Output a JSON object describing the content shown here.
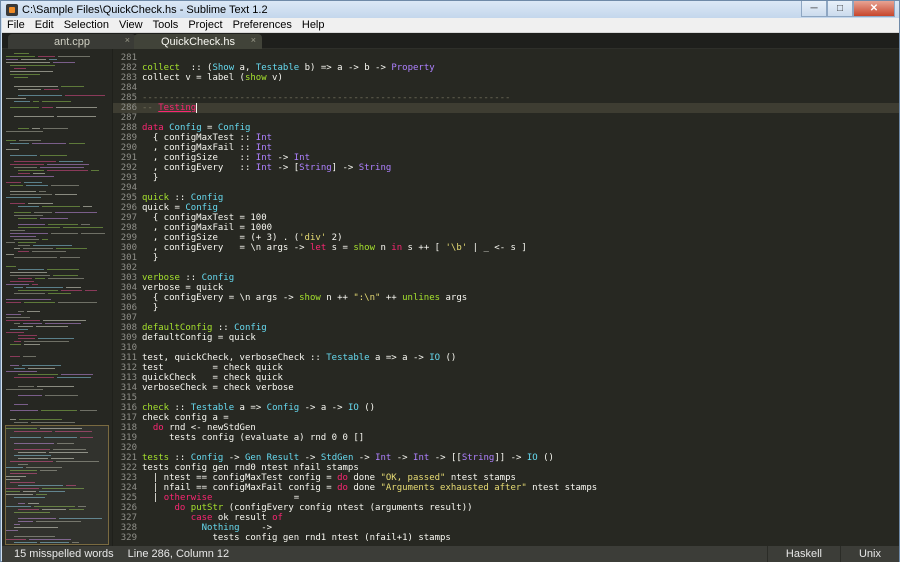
{
  "window": {
    "title": "C:\\Sample Files\\QuickCheck.hs - Sublime Text 1.2",
    "controls": [
      "minimize",
      "maximize",
      "close"
    ]
  },
  "menubar": {
    "items": [
      "File",
      "Edit",
      "Selection",
      "View",
      "Tools",
      "Project",
      "Preferences",
      "Help"
    ]
  },
  "tabs": [
    {
      "label": "ant.cpp",
      "active": false,
      "close": "×"
    },
    {
      "label": "QuickCheck.hs",
      "active": true,
      "close": "×"
    }
  ],
  "editor": {
    "current_line": "286",
    "lines": [
      {
        "n": "281",
        "tokens": []
      },
      {
        "n": "282",
        "tokens": [
          [
            "f",
            "collect"
          ],
          [
            "",
            "  :: ("
          ],
          [
            "t",
            "Show"
          ],
          [
            "",
            " a, "
          ],
          [
            "t",
            "Testable"
          ],
          [
            "",
            " b) => a -> b -> "
          ],
          [
            "typ",
            "Property"
          ]
        ]
      },
      {
        "n": "283",
        "tokens": [
          [
            "",
            "collect v = label ("
          ],
          [
            "f",
            "show"
          ],
          [
            "",
            " v)"
          ]
        ]
      },
      {
        "n": "284",
        "tokens": []
      },
      {
        "n": "285",
        "tokens": [
          [
            "c",
            "--------------------------------------------------------------------"
          ]
        ]
      },
      {
        "n": "286",
        "tokens": [
          [
            "c",
            "-- "
          ],
          [
            "err",
            "Testing"
          ]
        ]
      },
      {
        "n": "287",
        "tokens": []
      },
      {
        "n": "288",
        "tokens": [
          [
            "k",
            "data"
          ],
          [
            "",
            " "
          ],
          [
            "t",
            "Config"
          ],
          [
            "",
            " = "
          ],
          [
            "t",
            "Config"
          ]
        ]
      },
      {
        "n": "289",
        "tokens": [
          [
            "",
            "  { configMaxTest :: "
          ],
          [
            "typ",
            "Int"
          ]
        ]
      },
      {
        "n": "290",
        "tokens": [
          [
            "",
            "  , configMaxFail :: "
          ],
          [
            "typ",
            "Int"
          ]
        ]
      },
      {
        "n": "291",
        "tokens": [
          [
            "",
            "  , configSize    :: "
          ],
          [
            "typ",
            "Int"
          ],
          [
            "",
            " -> "
          ],
          [
            "typ",
            "Int"
          ]
        ]
      },
      {
        "n": "292",
        "tokens": [
          [
            "",
            "  , configEvery   :: "
          ],
          [
            "typ",
            "Int"
          ],
          [
            "",
            " -> ["
          ],
          [
            "typ",
            "String"
          ],
          [
            "",
            "] -> "
          ],
          [
            "typ",
            "String"
          ]
        ]
      },
      {
        "n": "293",
        "tokens": [
          [
            "",
            "  }"
          ]
        ]
      },
      {
        "n": "294",
        "tokens": []
      },
      {
        "n": "295",
        "tokens": [
          [
            "f",
            "quick"
          ],
          [
            "",
            " :: "
          ],
          [
            "t",
            "Config"
          ]
        ]
      },
      {
        "n": "296",
        "tokens": [
          [
            "",
            "quick = "
          ],
          [
            "t",
            "Config"
          ]
        ]
      },
      {
        "n": "297",
        "tokens": [
          [
            "",
            "  { configMaxTest = 100"
          ]
        ]
      },
      {
        "n": "298",
        "tokens": [
          [
            "",
            "  , configMaxFail = 1000"
          ]
        ]
      },
      {
        "n": "299",
        "tokens": [
          [
            "",
            "  , configSize    = (+ 3) . ("
          ],
          [
            "s",
            "'div'"
          ],
          [
            "",
            " 2)"
          ]
        ]
      },
      {
        "n": "300",
        "tokens": [
          [
            "",
            "  , configEvery   = \\n args -> "
          ],
          [
            "k",
            "let"
          ],
          [
            "",
            " s = "
          ],
          [
            "f",
            "show"
          ],
          [
            "",
            " n "
          ],
          [
            "k",
            "in"
          ],
          [
            "",
            " s ++ [ "
          ],
          [
            "s",
            "'\\b'"
          ],
          [
            "",
            " | _ <- s ]"
          ]
        ]
      },
      {
        "n": "301",
        "tokens": [
          [
            "",
            "  }"
          ]
        ]
      },
      {
        "n": "302",
        "tokens": []
      },
      {
        "n": "303",
        "tokens": [
          [
            "f",
            "verbose"
          ],
          [
            "",
            " :: "
          ],
          [
            "t",
            "Config"
          ]
        ]
      },
      {
        "n": "304",
        "tokens": [
          [
            "",
            "verbose = quick"
          ]
        ]
      },
      {
        "n": "305",
        "tokens": [
          [
            "",
            "  { configEvery = \\n args -> "
          ],
          [
            "f",
            "show"
          ],
          [
            "",
            " n ++ "
          ],
          [
            "s",
            "\":\\n\""
          ],
          [
            "",
            " ++ "
          ],
          [
            "f",
            "unlines"
          ],
          [
            "",
            " args"
          ]
        ]
      },
      {
        "n": "306",
        "tokens": [
          [
            "",
            "  }"
          ]
        ]
      },
      {
        "n": "307",
        "tokens": []
      },
      {
        "n": "308",
        "tokens": [
          [
            "f",
            "defaultConfig"
          ],
          [
            "",
            " :: "
          ],
          [
            "t",
            "Config"
          ]
        ]
      },
      {
        "n": "309",
        "tokens": [
          [
            "",
            "defaultConfig = quick"
          ]
        ]
      },
      {
        "n": "310",
        "tokens": []
      },
      {
        "n": "311",
        "tokens": [
          [
            "",
            "test, quickCheck, verboseCheck :: "
          ],
          [
            "t",
            "Testable"
          ],
          [
            "",
            " a => a -> "
          ],
          [
            "t",
            "IO"
          ],
          [
            "",
            " ()"
          ]
        ]
      },
      {
        "n": "312",
        "tokens": [
          [
            "",
            "test         = check quick"
          ]
        ]
      },
      {
        "n": "313",
        "tokens": [
          [
            "",
            "quickCheck   = check quick"
          ]
        ]
      },
      {
        "n": "314",
        "tokens": [
          [
            "",
            "verboseCheck = check verbose"
          ]
        ]
      },
      {
        "n": "315",
        "tokens": []
      },
      {
        "n": "316",
        "tokens": [
          [
            "f",
            "check"
          ],
          [
            "",
            " :: "
          ],
          [
            "t",
            "Testable"
          ],
          [
            "",
            " a => "
          ],
          [
            "t",
            "Config"
          ],
          [
            "",
            " -> a -> "
          ],
          [
            "t",
            "IO"
          ],
          [
            "",
            " ()"
          ]
        ]
      },
      {
        "n": "317",
        "tokens": [
          [
            "",
            "check config a ="
          ]
        ]
      },
      {
        "n": "318",
        "tokens": [
          [
            "",
            "  "
          ],
          [
            "k",
            "do"
          ],
          [
            "",
            " rnd <- newStdGen"
          ]
        ]
      },
      {
        "n": "319",
        "tokens": [
          [
            "",
            "     tests config (evaluate a) rnd 0 0 []"
          ]
        ]
      },
      {
        "n": "320",
        "tokens": []
      },
      {
        "n": "321",
        "tokens": [
          [
            "f",
            "tests"
          ],
          [
            "",
            " :: "
          ],
          [
            "t",
            "Config"
          ],
          [
            "",
            " -> "
          ],
          [
            "t",
            "Gen"
          ],
          [
            "",
            " "
          ],
          [
            "t",
            "Result"
          ],
          [
            "",
            " -> "
          ],
          [
            "t",
            "StdGen"
          ],
          [
            "",
            " -> "
          ],
          [
            "typ",
            "Int"
          ],
          [
            "",
            " -> "
          ],
          [
            "typ",
            "Int"
          ],
          [
            "",
            " -> [["
          ],
          [
            "typ",
            "String"
          ],
          [
            "",
            "]] -> "
          ],
          [
            "t",
            "IO"
          ],
          [
            "",
            " ()"
          ]
        ]
      },
      {
        "n": "322",
        "tokens": [
          [
            "",
            "tests config gen rnd0 ntest nfail stamps"
          ]
        ]
      },
      {
        "n": "323",
        "tokens": [
          [
            "",
            "  | ntest == configMaxTest config = "
          ],
          [
            "k",
            "do"
          ],
          [
            "",
            " done "
          ],
          [
            "s",
            "\"OK, passed\""
          ],
          [
            "",
            " ntest stamps"
          ]
        ]
      },
      {
        "n": "324",
        "tokens": [
          [
            "",
            "  | nfail == configMaxFail config = "
          ],
          [
            "k",
            "do"
          ],
          [
            "",
            " done "
          ],
          [
            "s",
            "\"Arguments exhausted after\""
          ],
          [
            "",
            " ntest stamps"
          ]
        ]
      },
      {
        "n": "325",
        "tokens": [
          [
            "",
            "  | "
          ],
          [
            "k",
            "otherwise"
          ],
          [
            "",
            "               ="
          ]
        ]
      },
      {
        "n": "326",
        "tokens": [
          [
            "",
            "      "
          ],
          [
            "k",
            "do"
          ],
          [
            "",
            " "
          ],
          [
            "f",
            "putStr"
          ],
          [
            "",
            " (configEvery config ntest (arguments result))"
          ]
        ]
      },
      {
        "n": "327",
        "tokens": [
          [
            "",
            "         "
          ],
          [
            "k",
            "case"
          ],
          [
            "",
            " ok result "
          ],
          [
            "k",
            "of"
          ]
        ]
      },
      {
        "n": "328",
        "tokens": [
          [
            "",
            "           "
          ],
          [
            "t",
            "Nothing"
          ],
          [
            "",
            "    ->"
          ]
        ]
      },
      {
        "n": "329",
        "tokens": [
          [
            "",
            "             tests config gen rnd1 ntest (nfail+1) stamps"
          ]
        ]
      }
    ]
  },
  "statusbar": {
    "spelling": "15 misspelled words",
    "position": "Line 286, Column 12",
    "syntax": "Haskell",
    "line_endings": "Unix"
  }
}
